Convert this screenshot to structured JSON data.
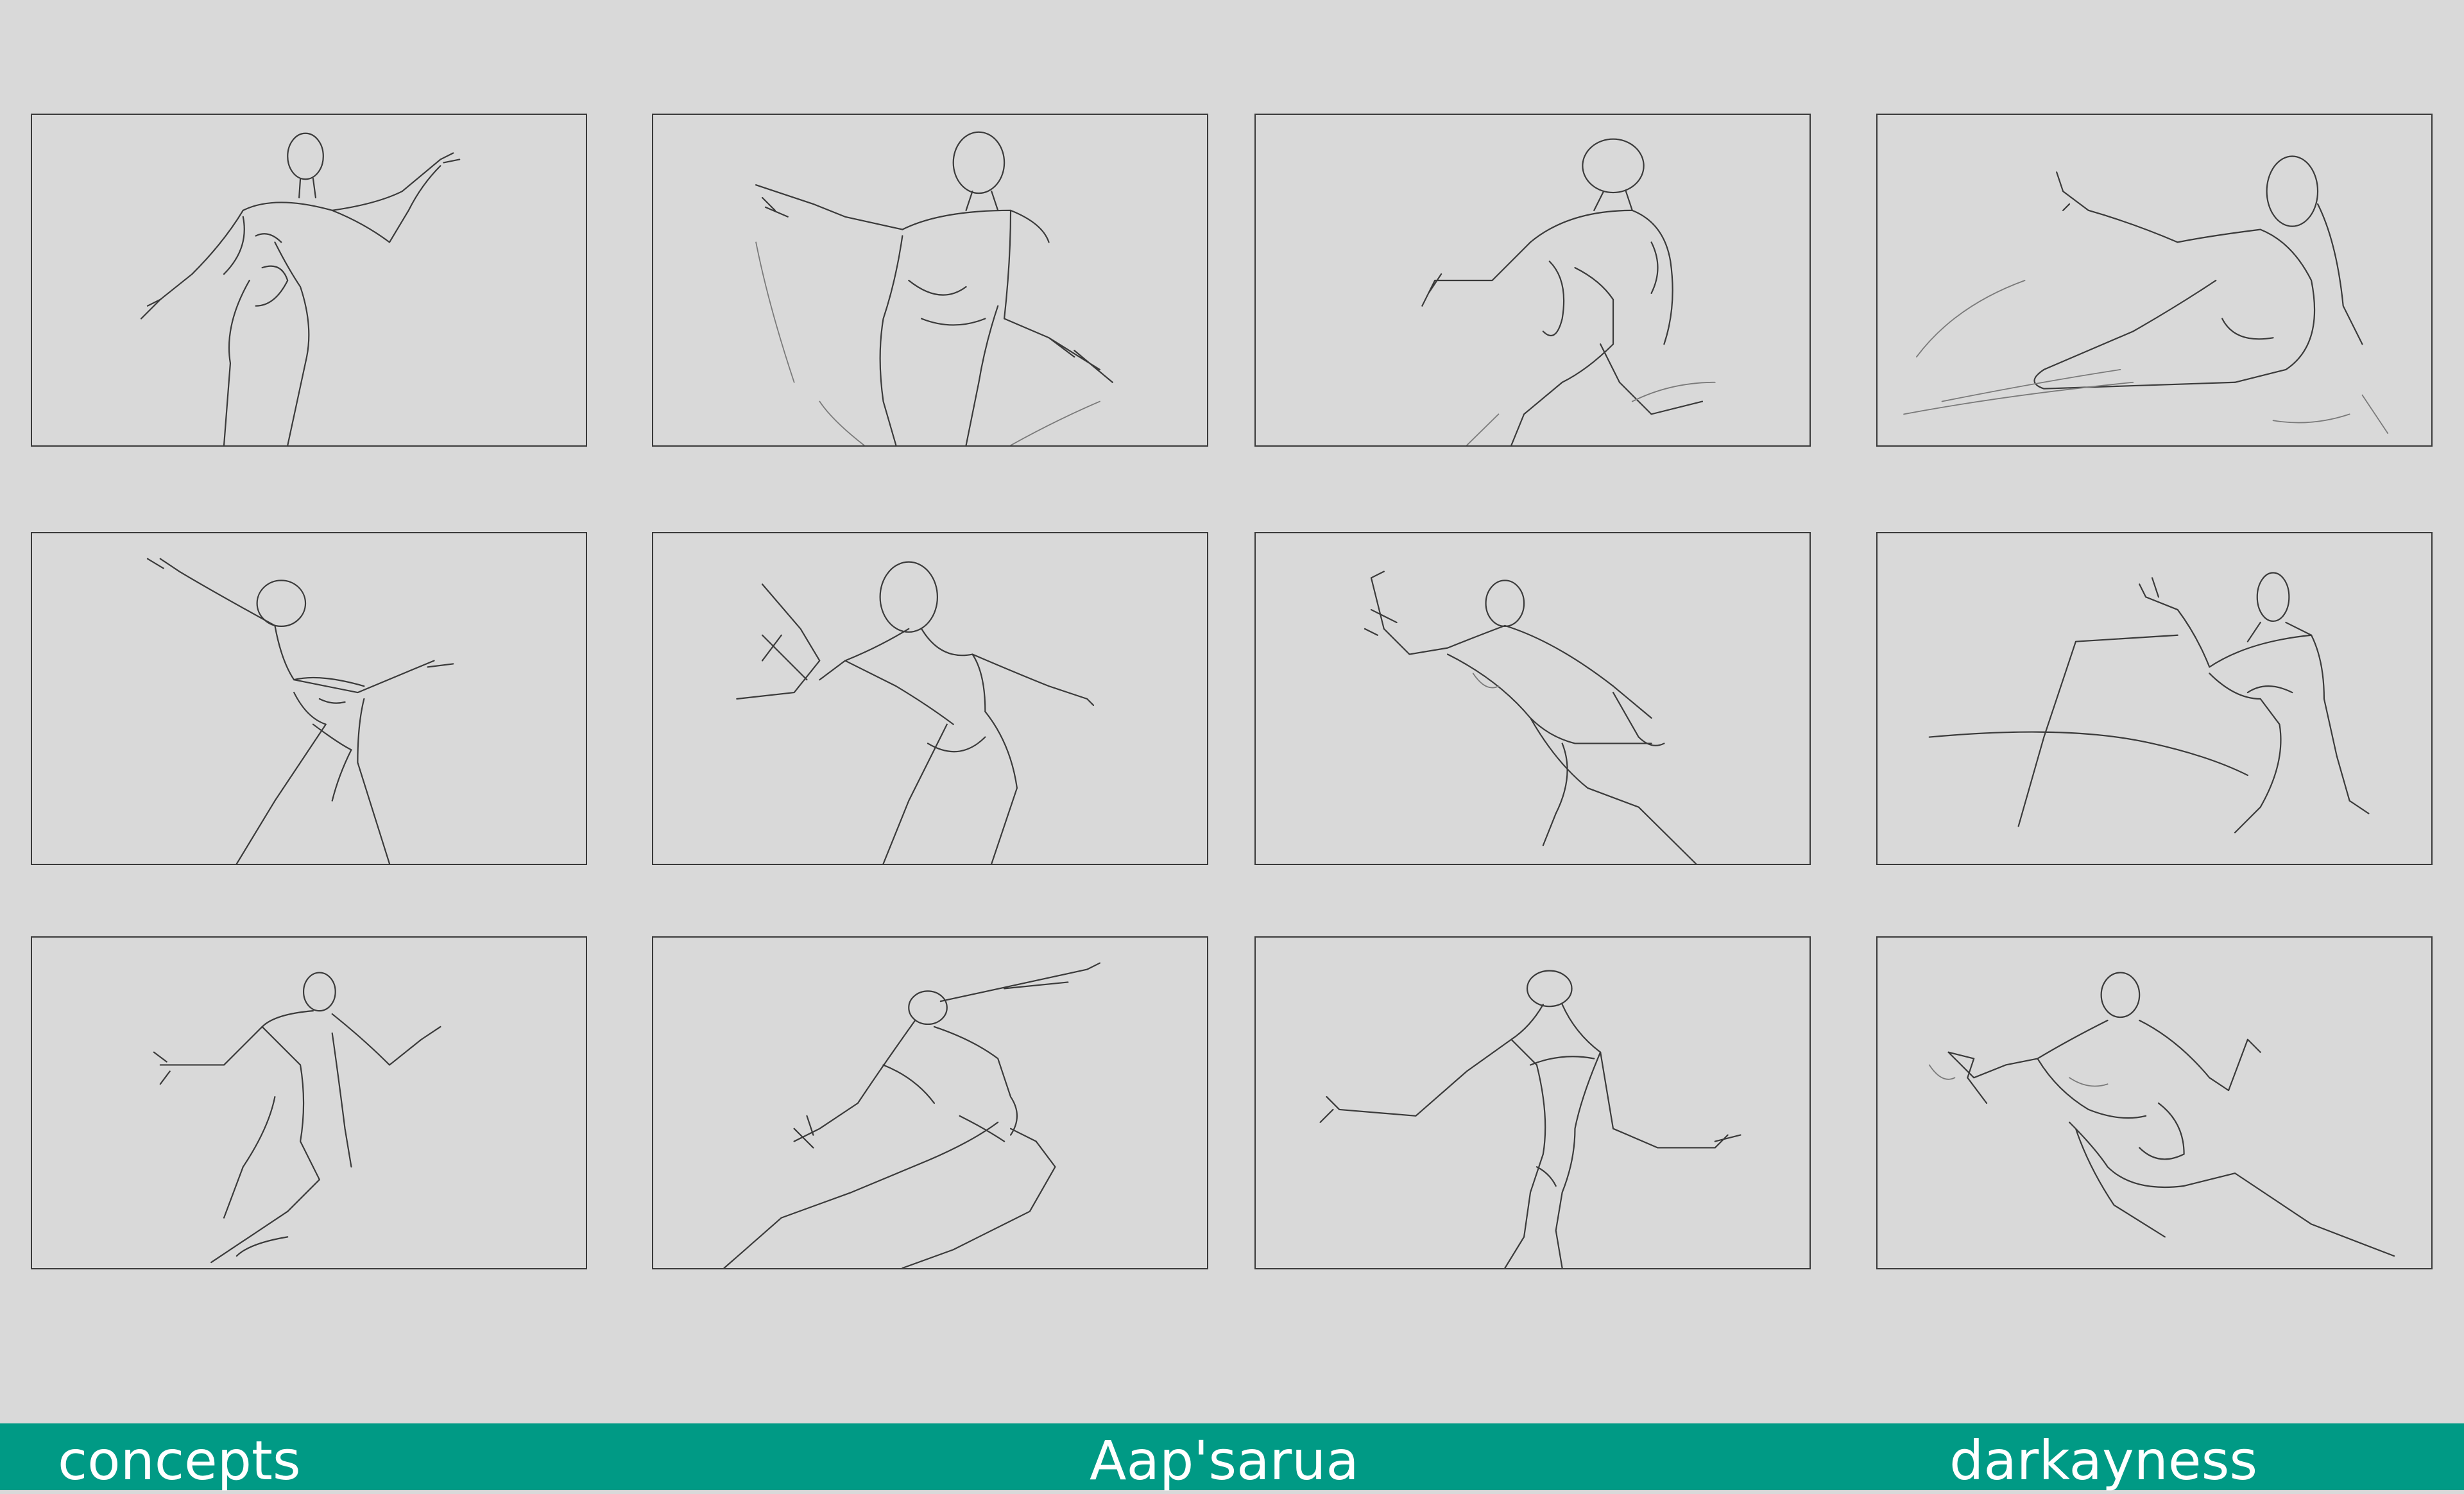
{
  "footer": {
    "left": "concepts",
    "center": "Aap'sarua",
    "right": "darkayness",
    "background": "#009a85",
    "text_color": "#ffffff"
  },
  "sheet": {
    "background": "#d9d9d9",
    "panel_border": "#3a3a3a",
    "rows": 3,
    "columns": 4,
    "panels": [
      {
        "subject": "standing-pose-arm-raised"
      },
      {
        "subject": "lunging-pose-clawed-hands"
      },
      {
        "subject": "muscular-crouch-reaching"
      },
      {
        "subject": "reclining-pose-arm-extended"
      },
      {
        "subject": "dancing-pose-arm-up"
      },
      {
        "subject": "lunging-pose-claws-forward"
      },
      {
        "subject": "muscular-crouch-claw-raised"
      },
      {
        "subject": "seated-pose-knee-up"
      },
      {
        "subject": "twisting-pose-arms-out"
      },
      {
        "subject": "flying-leap-pose"
      },
      {
        "subject": "standing-pose-arms-spread"
      },
      {
        "subject": "reclining-muscular-pose"
      }
    ]
  }
}
